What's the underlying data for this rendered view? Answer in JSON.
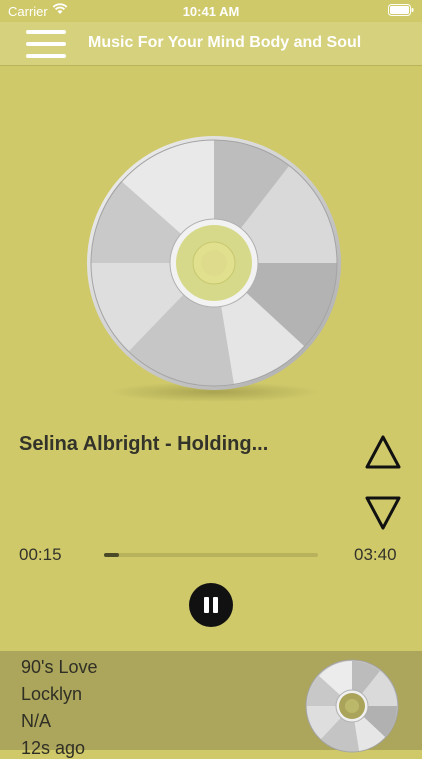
{
  "status_bar": {
    "carrier": "Carrier",
    "time": "10:41 AM"
  },
  "nav": {
    "menu_icon": "hamburger-menu-icon",
    "title": "Music For Your Mind Body and Soul"
  },
  "player": {
    "album_art_icon": "cd-disc-icon",
    "track_title": "Selina Albright -  Holding...",
    "elapsed": "00:15",
    "duration": "03:40",
    "progress_fraction": 0.068,
    "up_icon": "triangle-up-icon",
    "down_icon": "triangle-down-icon",
    "play_pause_icon": "pause-icon"
  },
  "history": {
    "song": "90's Love",
    "artist": "Locklyn",
    "album": "N/A",
    "played": "12s ago",
    "thumb_icon": "cd-disc-icon"
  },
  "colors": {
    "background": "#cfc96a",
    "nav_background": "#d6d17c",
    "history_background": "#aca55c",
    "disc_center": "#d8d98a"
  }
}
